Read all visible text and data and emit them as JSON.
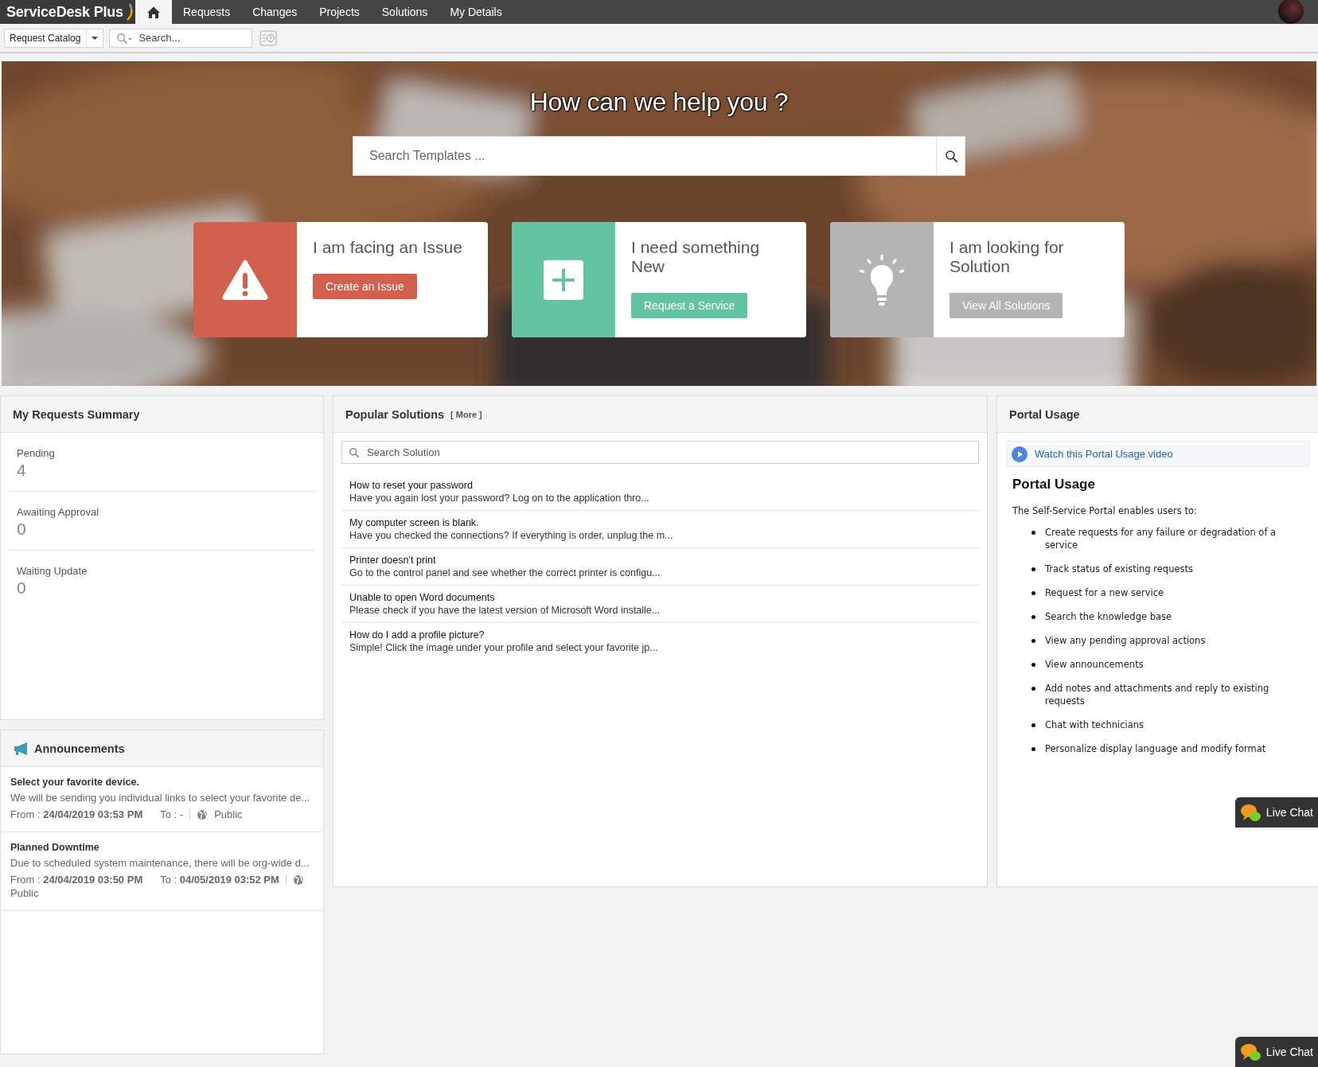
{
  "logo": {
    "text": "ServiceDesk Plus"
  },
  "tabs": [
    {
      "kind": "home",
      "selected": true
    },
    {
      "kind": "text",
      "label": "Requests",
      "selected": false
    },
    {
      "kind": "text",
      "label": "Changes",
      "selected": false
    },
    {
      "kind": "text",
      "label": "Projects",
      "selected": false
    },
    {
      "kind": "text",
      "label": "Solutions",
      "selected": false
    },
    {
      "kind": "text",
      "label": "My Details",
      "selected": false
    }
  ],
  "toolbar": {
    "catalog_dropdown": {
      "value": "Request Catalog"
    },
    "search": {
      "placeholder": "Search..."
    }
  },
  "hero": {
    "title": "How can we help you ?",
    "search": {
      "placeholder": "Search Templates ..."
    },
    "cards": [
      {
        "kind": "issue",
        "title": "I am facing an Issue",
        "button": "Create an Issue",
        "color": "#d2604f"
      },
      {
        "kind": "service",
        "title": "I need something New",
        "button": "Request a Service",
        "color": "#62c5a0"
      },
      {
        "kind": "solution",
        "title": "I am looking for Solution",
        "button": "View All Solutions",
        "color": "#b4b4b4"
      }
    ]
  },
  "requests_summary": {
    "title": "My Requests Summary",
    "stats": [
      {
        "label": "Pending",
        "value": "4"
      },
      {
        "label": "Awaiting Approval",
        "value": "0"
      },
      {
        "label": "Waiting Update",
        "value": "0"
      }
    ]
  },
  "announcements": {
    "title": "Announcements",
    "items": [
      {
        "title": "Select your favorite device.",
        "body": "We will be sending you individual links to select your favorite de...",
        "from": "From : **24/04/2019 03:53 PM**",
        "to": "To : -",
        "visibility": "Public"
      },
      {
        "title": "Planned Downtime",
        "body": "Due to scheduled system maintenance, there will be org-wide d...",
        "from": "From : **24/04/2019 03:50 PM**",
        "to": "To : **04/05/2019 03:52 PM**",
        "visibility": "Public"
      }
    ]
  },
  "popular_solutions": {
    "title": "Popular Solutions",
    "more_link": "[ More ]",
    "search": {
      "placeholder": "Search Solution"
    },
    "items": [
      {
        "title": "How to reset your password",
        "summary": "Have you again lost your password? Log on to the application thro..."
      },
      {
        "title": "My computer screen is blank.",
        "summary": "Have you checked the connections? If everything is order, unplug the m..."
      },
      {
        "title": "Printer doesn’t print",
        "summary": "Go to the control panel and see whether the correct printer is configu..."
      },
      {
        "title": "Unable to open Word documents",
        "summary": "Please check if you have the latest version of Microsoft Word installe..."
      },
      {
        "title": "How do I add a profile picture?",
        "summary": "Simple! Click the image under your profile and select your favorite jp..."
      }
    ]
  },
  "portal_usage": {
    "title": "Portal Usage",
    "video_link": "Watch this Portal Usage video",
    "heading": "Portal Usage",
    "intro": "The Self-Service Portal enables users to:",
    "bullets": [
      "Create requests for any failure or degradation of a service",
      "Track status of existing requests",
      "Request for a new service",
      "Search the knowledge base",
      "View any pending approval actions",
      "View announcements",
      "Add notes and attachments and reply to existing requests",
      "Chat with technicians",
      "Personalize display language and modify format"
    ]
  },
  "live_chat": [
    {
      "label": "Live Chat"
    },
    {
      "label": "Live Chat"
    }
  ]
}
